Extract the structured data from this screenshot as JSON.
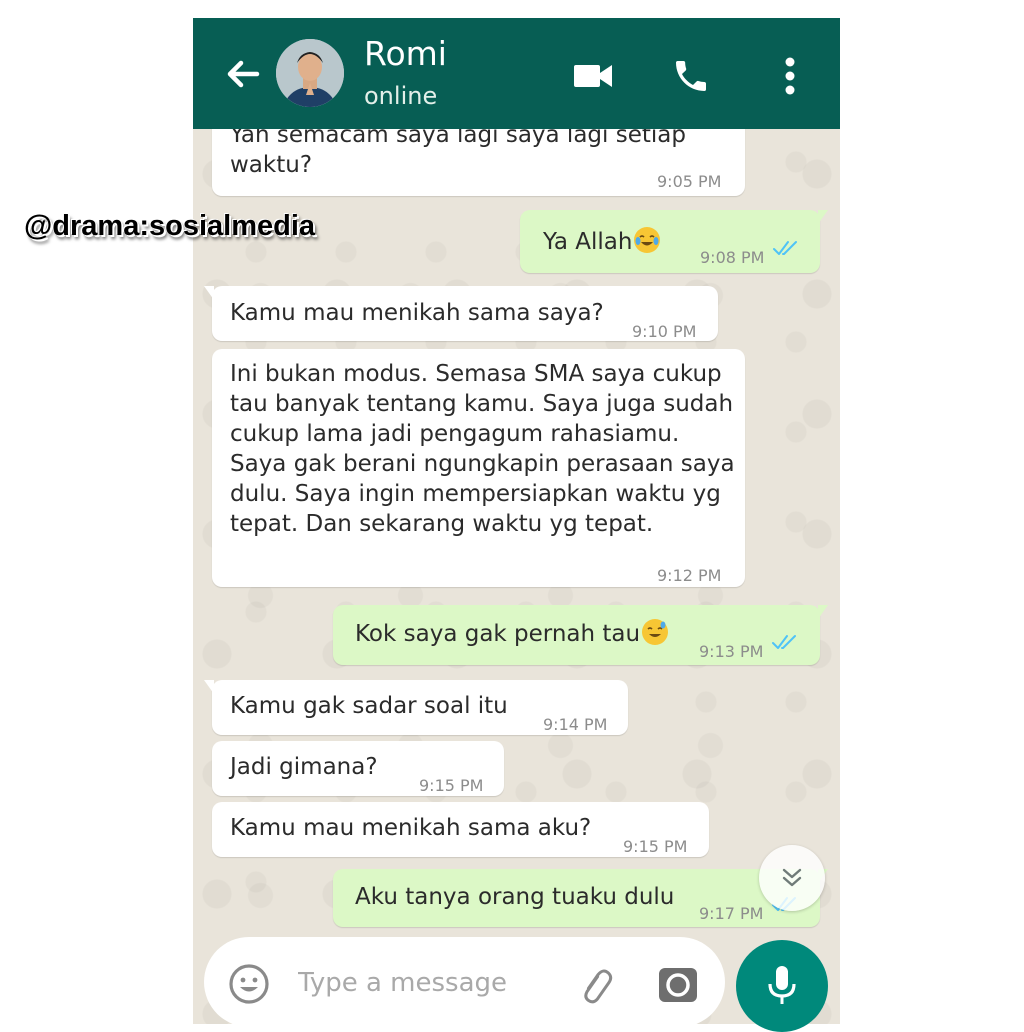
{
  "watermark": "@drama:sosialmedia",
  "header": {
    "contact_name": "Romi",
    "status": "online"
  },
  "messages": [
    {
      "direction": "in",
      "lines": [
        "Yah semacam saya lagi saya lagi setiap",
        "waktu?"
      ],
      "time": "9:05 PM"
    },
    {
      "direction": "out",
      "lines": [
        "Ya Allah"
      ],
      "emoji": "tears-of-joy-emoji",
      "time": "9:08 PM",
      "status": "read"
    },
    {
      "direction": "in",
      "lines": [
        "Kamu mau menikah sama saya?"
      ],
      "time": "9:10 PM"
    },
    {
      "direction": "in",
      "lines": [
        "Ini bukan modus. Semasa SMA saya cukup",
        "tau banyak tentang kamu. Saya juga sudah",
        "cukup lama jadi pengagum rahasiamu.",
        "Saya gak berani ngungkapin perasaan saya",
        "dulu. Saya ingin mempersiapkan waktu yg",
        "tepat. Dan sekarang waktu yg tepat."
      ],
      "time": "9:12 PM"
    },
    {
      "direction": "out",
      "lines": [
        "Kok saya gak pernah tau"
      ],
      "emoji": "grinning-sweat-emoji",
      "time": "9:13 PM",
      "status": "read"
    },
    {
      "direction": "in",
      "lines": [
        "Kamu gak sadar soal itu"
      ],
      "time": "9:14 PM"
    },
    {
      "direction": "in",
      "lines": [
        "Jadi gimana?"
      ],
      "time": "9:15 PM"
    },
    {
      "direction": "in",
      "lines": [
        "Kamu mau menikah sama aku?"
      ],
      "time": "9:15 PM"
    },
    {
      "direction": "out",
      "lines": [
        "Aku tanya orang tuaku dulu"
      ],
      "time": "9:17 PM",
      "status": "read"
    }
  ],
  "composer": {
    "placeholder": "Type a message"
  },
  "colors": {
    "header": "#075e54",
    "outgoing_bubble": "#dcf8c6",
    "incoming_bubble": "#ffffff",
    "mic_button": "#00897b",
    "read_ticks": "#4fc3f7"
  }
}
